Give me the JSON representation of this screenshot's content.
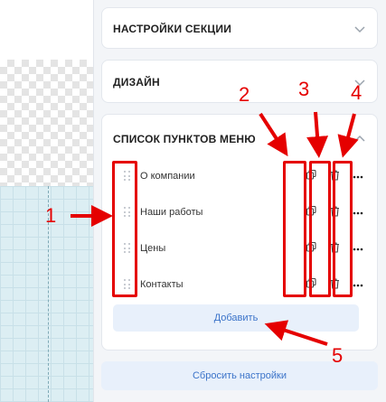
{
  "sections": {
    "settings_title": "НАСТРОЙКИ СЕКЦИИ",
    "design_title": "ДИЗАЙН",
    "menu_list_title": "СПИСОК ПУНКТОВ МЕНЮ"
  },
  "menu_items": [
    {
      "label": "О компании"
    },
    {
      "label": "Наши работы"
    },
    {
      "label": "Цены"
    },
    {
      "label": "Контакты"
    }
  ],
  "add_button": "Добавить",
  "reset_button": "Сбросить настройки",
  "icons": {
    "copy": "copy-icon",
    "delete": "trash-icon",
    "more": "more-icon",
    "drag": "drag-handle-icon",
    "chevron": "chevron-icon"
  },
  "annotations": {
    "labels": [
      "1",
      "2",
      "3",
      "4",
      "5"
    ],
    "color": "#e50000"
  }
}
